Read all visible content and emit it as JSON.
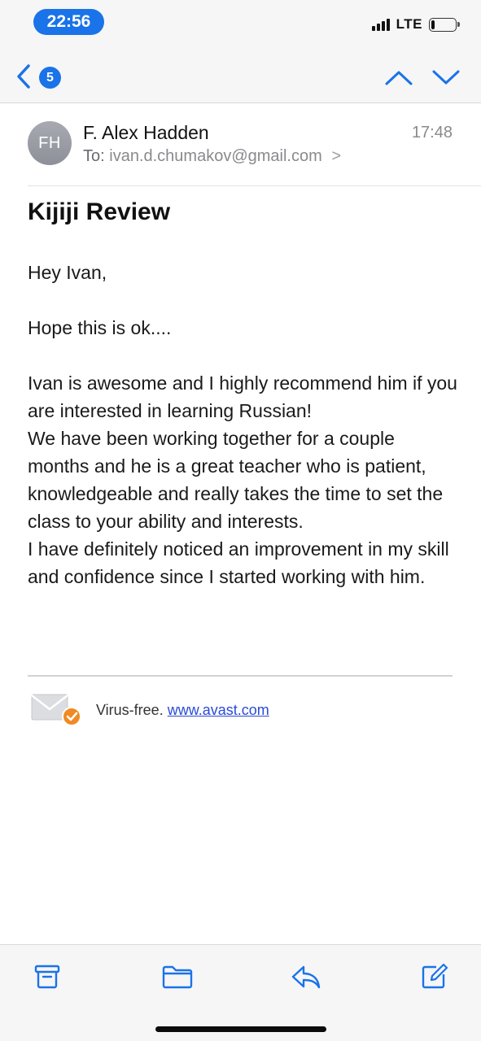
{
  "status_bar": {
    "time": "22:56",
    "network": "LTE",
    "battery_level": 0.15
  },
  "nav": {
    "back_badge": "5",
    "icons": [
      "chevron-left-icon",
      "chevron-up-icon",
      "chevron-down-icon"
    ]
  },
  "message": {
    "avatar_initials": "FH",
    "sender": "F. Alex Hadden",
    "time": "17:48",
    "to_label": "To:",
    "to_address": "ivan.d.chumakov@gmail.com",
    "to_chevron": ">",
    "subject": "Kijiji Review",
    "greeting": "Hey Ivan,",
    "line1": "Hope this is ok....",
    "para1": "Ivan is awesome and I highly recommend him if you are interested in learning Russian!",
    "para2": "We have been working together for a couple months and he is a great teacher who is patient, knowledgeable and really takes the time to set the class to your ability and interests.",
    "para3": "I have definitely noticed an improvement in my skill and confidence since I started working with him."
  },
  "signature": {
    "text": "Virus-free.",
    "link": "www.avast.com"
  },
  "toolbar": {
    "icons": [
      "archive-icon",
      "folder-icon",
      "reply-icon",
      "compose-icon"
    ]
  },
  "colors": {
    "accent": "#1a73e8",
    "avatar": "#9a9ca4",
    "bar_bg": "#f6f6f7",
    "link": "#2a4bd6",
    "avast_orange": "#f08a24"
  }
}
